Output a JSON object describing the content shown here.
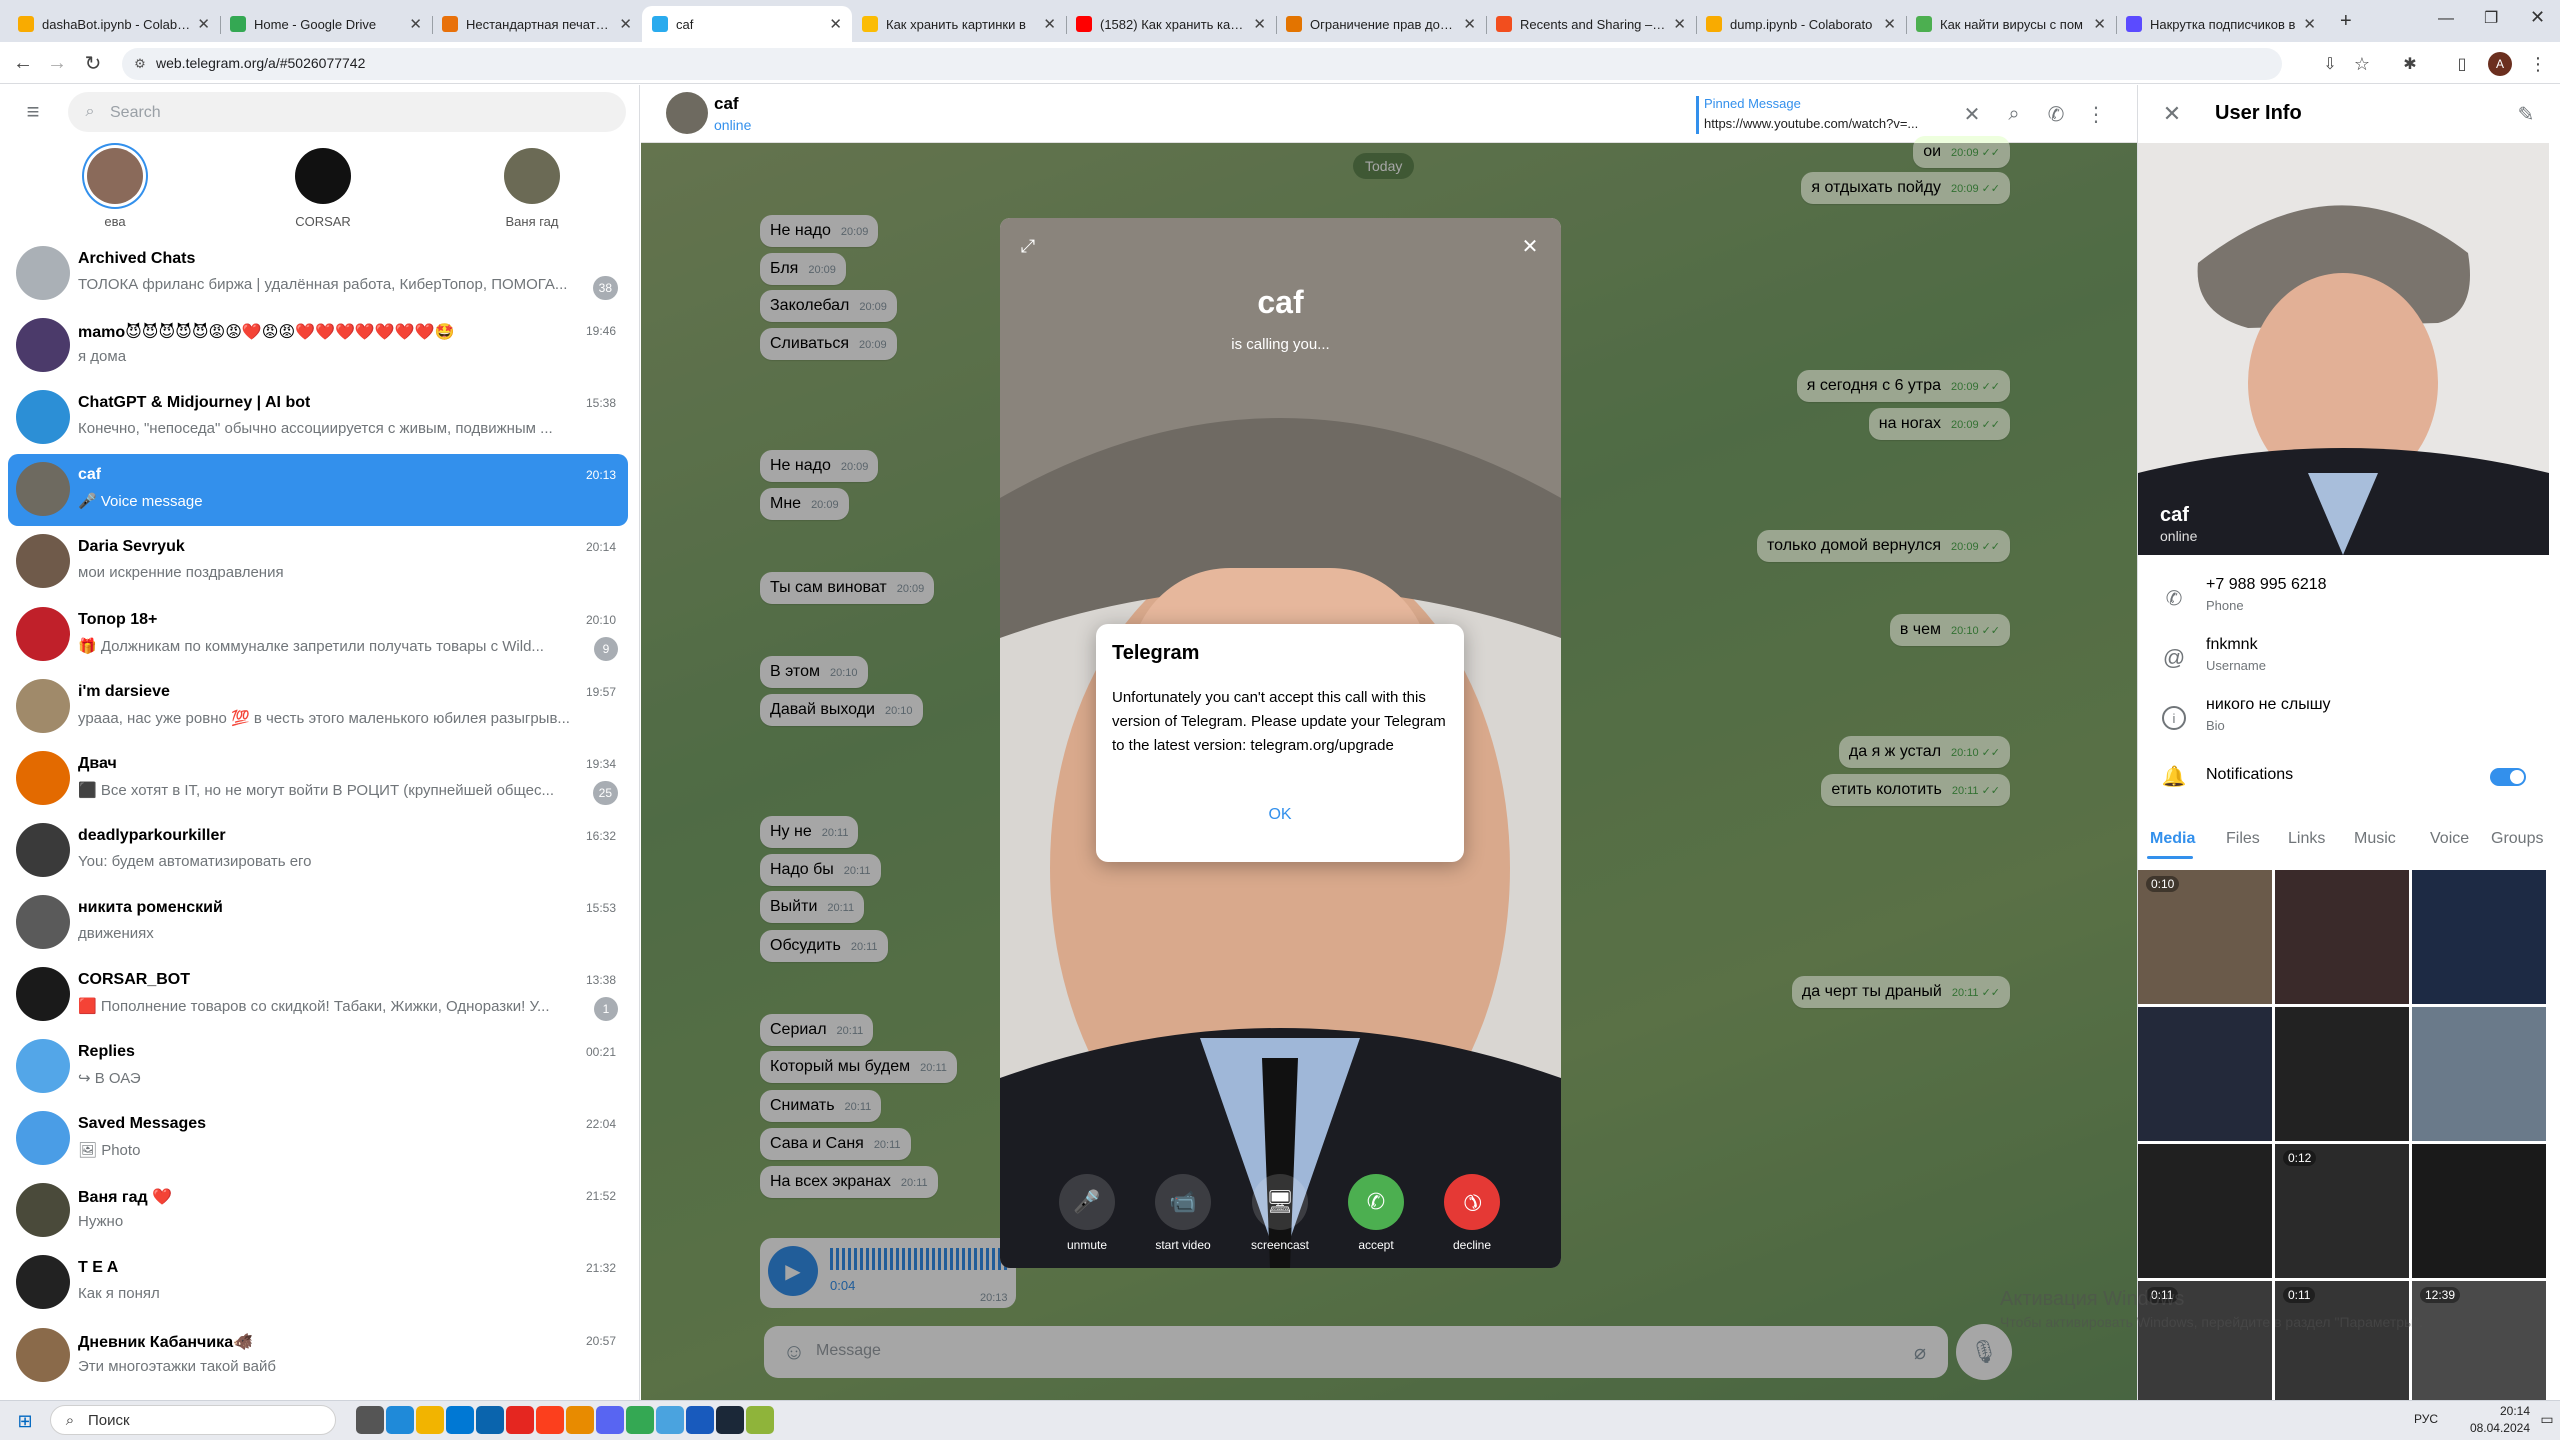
{
  "browser": {
    "tabs": [
      {
        "title": "dashaBot.ipynb - Colabora",
        "color": "#f9ab00"
      },
      {
        "title": "Home - Google Drive",
        "color": "#34a853"
      },
      {
        "title": "Нестандартная печатная",
        "color": "#e8710a"
      },
      {
        "title": "caf",
        "color": "#2aabee"
      },
      {
        "title": "Как хранить картинки в",
        "color": "#fbbc04"
      },
      {
        "title": "(1582) Как хранить карти",
        "color": "#ff0000"
      },
      {
        "title": "Ограничение прав досту",
        "color": "#e37400"
      },
      {
        "title": "Recents and Sharing – Fig",
        "color": "#f24e1e"
      },
      {
        "title": "dump.ipynb - Colaborato",
        "color": "#f9ab00"
      },
      {
        "title": "Как найти вирусы с пом",
        "color": "#4caf50"
      },
      {
        "title": "Накрутка подписчиков в",
        "color": "#5b4bff"
      }
    ],
    "url": "web.telegram.org/a/#5026077742",
    "profile_letter": "A"
  },
  "left": {
    "search_placeholder": "Search",
    "stories": [
      {
        "name": "ева",
        "color": "#8a6a5a"
      },
      {
        "name": "CORSAR",
        "color": "#111111"
      },
      {
        "name": "Ваня гад",
        "color": "#6b6a55"
      }
    ],
    "chats": [
      {
        "name": "Archived Chats",
        "preview": "ТОЛОКА фриланс биржа | удалённая работа, КиберТопор, ПОМОГА...",
        "time": "",
        "badge": "38",
        "color": "#aab0b6"
      },
      {
        "name": "mamo😈😈😈😈😈😡😡❤️😡😡❤️❤️❤️❤️❤️❤️❤️🤩",
        "preview": "я дома",
        "time": "19:46",
        "badge": "",
        "color": "#4b3a6a"
      },
      {
        "name": "ChatGPT & Midjourney | AI bot",
        "preview": "Конечно, \"непоседа\" обычно ассоциируется с живым, подвижным ...",
        "time": "15:38",
        "badge": "",
        "color": "#2c8fd6"
      },
      {
        "name": "caf",
        "preview": "🎤 Voice message",
        "time": "20:13",
        "badge": "",
        "color": "#6e6a60"
      },
      {
        "name": "Daria Sevryuk",
        "preview": "мои искренние поздравления",
        "time": "20:14",
        "badge": "",
        "color": "#6f5a4a"
      },
      {
        "name": "Топор 18+",
        "preview": "🎁 Должникам по коммуналке запретили получать товары с Wild...",
        "time": "20:10",
        "badge": "9",
        "color": "#c0202a"
      },
      {
        "name": "i'm darsieve",
        "preview": "урааа, нас уже ровно 💯 в честь этого маленького юбилея разыгрыв...",
        "time": "19:57",
        "badge": "",
        "color": "#a08a6a"
      },
      {
        "name": "Двач",
        "preview": "⬛ Все хотят в IT, но не могут войти В РОЦИТ (крупнейшей общес...",
        "time": "19:34",
        "badge": "25",
        "color": "#e36a00"
      },
      {
        "name": "deadlyparkourkiller",
        "preview": "You: будем автоматизировать его",
        "time": "16:32",
        "badge": "",
        "color": "#3a3a3a"
      },
      {
        "name": "никита роменский",
        "preview": "движениях",
        "time": "15:53",
        "badge": "",
        "color": "#5a5a5a"
      },
      {
        "name": "CORSAR_BOT",
        "preview": "🟥 Пополнение товаров со скидкой! Табаки, Жижки, Одноразки! У...",
        "time": "13:38",
        "badge": "1",
        "color": "#1a1a1a"
      },
      {
        "name": "Replies",
        "preview": "↪ В ОАЭ",
        "time": "00:21",
        "badge": "",
        "color": "#53a6e8"
      },
      {
        "name": "Saved Messages",
        "preview": "🖼 Photo",
        "time": "22:04",
        "badge": "",
        "color": "#4a9de6"
      },
      {
        "name": "Ваня гад ❤️",
        "preview": "Нужно",
        "time": "21:52",
        "badge": "",
        "color": "#4a4a3a"
      },
      {
        "name": "T E A",
        "preview": "Как я понял",
        "time": "21:32",
        "badge": "",
        "color": "#222222"
      },
      {
        "name": "Дневник Кабанчика🐗",
        "preview": "Эти многоэтажки такой вайб",
        "time": "20:57",
        "badge": "",
        "color": "#8a6a4a"
      }
    ]
  },
  "header": {
    "name": "caf",
    "status": "online",
    "pinned_title": "Pinned Message",
    "pinned_text": "https://www.youtube.com/watch?v=..."
  },
  "messages": {
    "date": "Today",
    "incoming": [
      {
        "text": "Не надо",
        "time": "20:09"
      },
      {
        "text": "Бля",
        "time": "20:09"
      },
      {
        "text": "Заколебал",
        "time": "20:09"
      },
      {
        "text": "Сливаться",
        "time": "20:09"
      },
      {
        "text": "Не надо",
        "time": "20:09"
      },
      {
        "text": "Мне",
        "time": "20:09"
      },
      {
        "text": "Ты сам виноват",
        "time": "20:09"
      },
      {
        "text": "В этом",
        "time": "20:10"
      },
      {
        "text": "Давай выходи",
        "time": "20:10"
      },
      {
        "text": "Ну не",
        "time": "20:11"
      },
      {
        "text": "Надо бы",
        "time": "20:11"
      },
      {
        "text": "Выйти",
        "time": "20:11"
      },
      {
        "text": "Обсудить",
        "time": "20:11"
      },
      {
        "text": "Сериал",
        "time": "20:11"
      },
      {
        "text": "Который мы будем",
        "time": "20:11"
      },
      {
        "text": "Снимать",
        "time": "20:11"
      },
      {
        "text": "Сава и Саня",
        "time": "20:11"
      },
      {
        "text": "На всех экранах",
        "time": "20:11"
      }
    ],
    "outgoing": [
      {
        "text": "ои",
        "time": "20:09"
      },
      {
        "text": "я отдыхать пойду",
        "time": "20:09"
      },
      {
        "text": "я сегодня с 6 утра",
        "time": "20:09"
      },
      {
        "text": "на ногах",
        "time": "20:09"
      },
      {
        "text": "только домой вернулся",
        "time": "20:09"
      },
      {
        "text": "в чем",
        "time": "20:10"
      },
      {
        "text": "да я ж устал",
        "time": "20:10"
      },
      {
        "text": "етить колотить",
        "time": "20:11"
      },
      {
        "text": "да черт ты драный",
        "time": "20:11"
      }
    ],
    "voice": {
      "duration": "0:04",
      "time": "20:13"
    },
    "composer_placeholder": "Message"
  },
  "call": {
    "name": "caf",
    "subtitle": "is calling you...",
    "buttons": [
      {
        "label": "unmute",
        "color": "rgba(255,255,255,0.15)"
      },
      {
        "label": "start video",
        "color": "rgba(255,255,255,0.15)"
      },
      {
        "label": "screencast",
        "color": "rgba(255,255,255,0.15)"
      },
      {
        "label": "accept",
        "color": "#4caf50"
      },
      {
        "label": "decline",
        "color": "#e53935"
      }
    ]
  },
  "dialog": {
    "title": "Telegram",
    "body": "Unfortunately you can't accept this call with this version of Telegram. Please update your Telegram to the latest version: telegram.org/upgrade",
    "ok": "OK"
  },
  "right": {
    "title": "User Info",
    "name": "caf",
    "status": "online",
    "phone": "+7 988 995 6218",
    "phone_label": "Phone",
    "username": "fnkmnk",
    "username_label": "Username",
    "bio": "никого не слышу",
    "bio_label": "Bio",
    "notifications": "Notifications",
    "tabs": [
      "Media",
      "Files",
      "Links",
      "Music",
      "Voice",
      "Groups"
    ],
    "media_labels": [
      "0:10",
      "",
      "",
      "",
      "",
      "",
      "",
      "0:12",
      "",
      "0:11",
      "0:11",
      "12:39"
    ],
    "watermark_title": "Активация Windows",
    "watermark_text": "Чтобы активировать Windows, перейдите в раздел \"Параметры\"."
  },
  "taskbar": {
    "search": "Поиск",
    "lang": "РУС",
    "time": "20:14",
    "date": "08.04.2024"
  }
}
